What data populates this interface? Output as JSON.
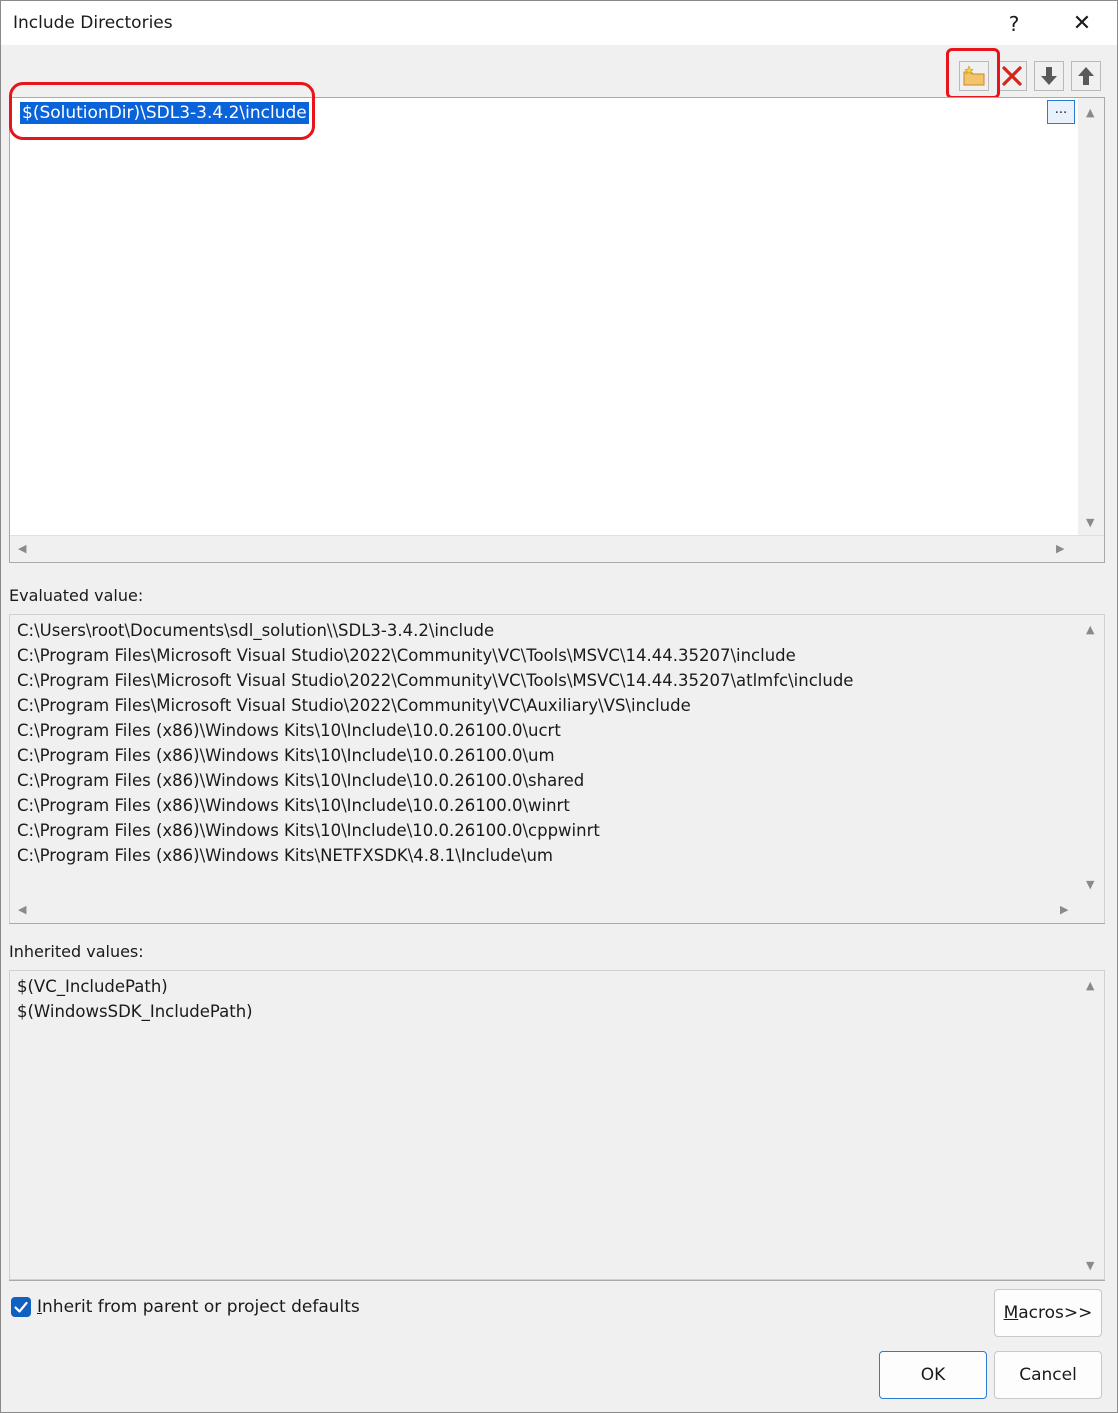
{
  "window": {
    "title": "Include Directories",
    "help_label": "?",
    "close_label": "✕"
  },
  "toolbar": {
    "new_line_icon": "new-folder-icon",
    "delete_icon": "delete-x-icon",
    "move_down_icon": "arrow-down-icon",
    "move_up_icon": "arrow-up-icon"
  },
  "editor": {
    "lines": [
      "$(SolutionDir)\\SDL3-3.4.2\\include"
    ],
    "browse_label": "..."
  },
  "evaluated": {
    "label": "Evaluated value:",
    "lines": [
      "C:\\Users\\root\\Documents\\sdl_solution\\\\SDL3-3.4.2\\include",
      "C:\\Program Files\\Microsoft Visual Studio\\2022\\Community\\VC\\Tools\\MSVC\\14.44.35207\\include",
      "C:\\Program Files\\Microsoft Visual Studio\\2022\\Community\\VC\\Tools\\MSVC\\14.44.35207\\atlmfc\\include",
      "C:\\Program Files\\Microsoft Visual Studio\\2022\\Community\\VC\\Auxiliary\\VS\\include",
      "C:\\Program Files (x86)\\Windows Kits\\10\\Include\\10.0.26100.0\\ucrt",
      "C:\\Program Files (x86)\\Windows Kits\\10\\Include\\10.0.26100.0\\um",
      "C:\\Program Files (x86)\\Windows Kits\\10\\Include\\10.0.26100.0\\shared",
      "C:\\Program Files (x86)\\Windows Kits\\10\\Include\\10.0.26100.0\\winrt",
      "C:\\Program Files (x86)\\Windows Kits\\10\\Include\\10.0.26100.0\\cppwinrt",
      "C:\\Program Files (x86)\\Windows Kits\\NETFXSDK\\4.8.1\\Include\\um"
    ]
  },
  "inherited": {
    "label": "Inherited values:",
    "lines": [
      "$(VC_IncludePath)",
      "$(WindowsSDK_IncludePath)"
    ]
  },
  "footer": {
    "inherit_checked": true,
    "inherit_label_mnemonic": "I",
    "inherit_label_rest": "nherit from parent or project defaults",
    "macros_mnemonic": "M",
    "macros_rest": "acros>>",
    "ok_label": "OK",
    "cancel_label": "Cancel"
  },
  "colors": {
    "selection": "#0a63d8",
    "highlight_annotation": "#e8141b",
    "checkbox": "#1060c0"
  }
}
